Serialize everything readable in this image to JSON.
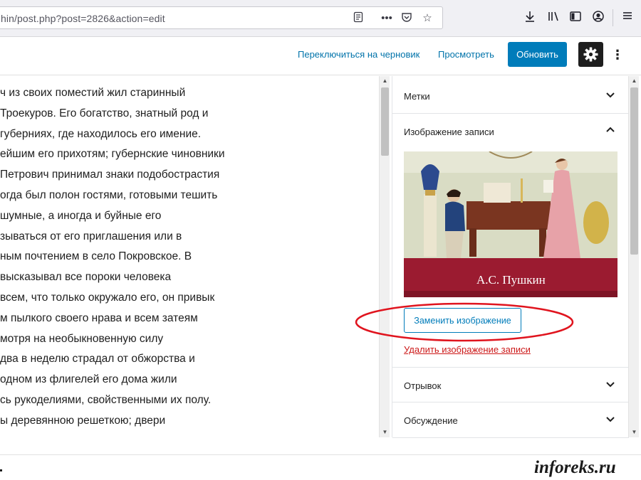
{
  "browser": {
    "url": "hin/post.php?post=2826&action=edit",
    "icons": [
      "reader-view-icon",
      "more-actions-icon",
      "pocket-icon",
      "bookmark-star-icon",
      "download-icon",
      "library-icon",
      "sidebar-icon",
      "account-icon",
      "menu-icon"
    ]
  },
  "header": {
    "switch_to_draft": "Переключиться на черновик",
    "preview": "Просмотреть",
    "update": "Обновить",
    "settings_icon": "gear-icon",
    "more_icon": "vertical-ellipsis-icon"
  },
  "content": {
    "lines": [
      "ч из своих поместий жил старинный",
      "Троекуров. Его богатство, знатный род и",
      "губерниях, где находилось его имение.",
      "ейшим его прихотям; губернские чиновники",
      " Петрович принимал знаки подобострастия",
      "огда был полон гостями, готовыми тешить",
      " шумные, а иногда и буйные его",
      "зываться от его приглашения или в",
      "ным почтением в село Покровское. В",
      " высказывал все пороки человека",
      "всем, что только окружало его, он привык",
      "м пылкого своего нрава и всем затеям",
      "мотря на необыкновенную силу",
      " два в неделю страдал от обжорства и",
      "одном из флигелей его дома жили",
      "сь рукоделиями, свойственными их полу.",
      "ы деревянною решеткою; двери"
    ]
  },
  "sidebar": {
    "tags_label": "Метки",
    "featured_label": "Изображение записи",
    "book_title": "А.С. Пушкин",
    "replace_image": "Заменить изображение",
    "remove_image": "Удалить изображение записи",
    "excerpt_label": "Отрывок",
    "discussion_label": "Обсуждение"
  },
  "colors": {
    "accent": "#007cba",
    "danger": "#cc1818",
    "annotation": "#e0141e",
    "book_band": "#9b1b30"
  },
  "watermark": "inforeks.ru"
}
